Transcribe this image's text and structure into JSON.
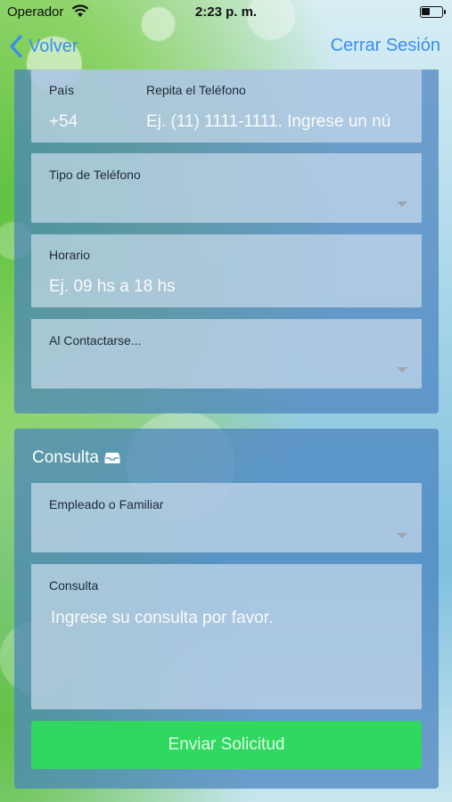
{
  "status_bar": {
    "carrier": "Operador",
    "time": "2:23 p. m."
  },
  "nav": {
    "back_label": "Volver",
    "logout_label": "Cerrar Sesión"
  },
  "contact": {
    "country_label": "País",
    "country_placeholder": "+54",
    "repeat_phone_label": "Repita el Teléfono",
    "repeat_phone_placeholder": "Ej. (11) 1111-1111. Ingrese un nú",
    "phone_type_label": "Tipo de Teléfono",
    "schedule_label": "Horario",
    "schedule_placeholder": "Ej. 09 hs a 18 hs",
    "on_contact_label": "Al Contactarse..."
  },
  "query": {
    "title": "Consulta",
    "employee_label": "Empleado o Familiar",
    "query_label": "Consulta",
    "query_placeholder": "Ingrese su consulta por favor.",
    "submit_label": "Enviar Solicitud"
  },
  "colors": {
    "accent": "#3a8df0",
    "submit": "#2fd85e",
    "card": "#4982be"
  }
}
